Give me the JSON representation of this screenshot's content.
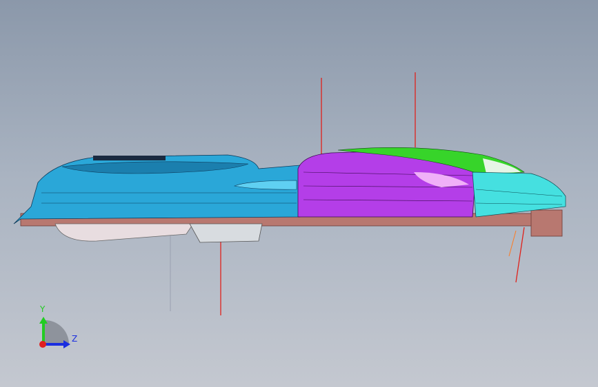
{
  "viewport": {
    "triad": {
      "y_label": "Y",
      "z_label": "Z"
    },
    "colors": {
      "background_top": "#8b98aa",
      "background_bottom": "#c4c8d0",
      "housing_blue": "#2aa7d8",
      "lens_purple": "#b43ee8",
      "glass_green": "#37d42a",
      "base_plate": "#b87870",
      "leader_red": "#e0201a"
    }
  }
}
